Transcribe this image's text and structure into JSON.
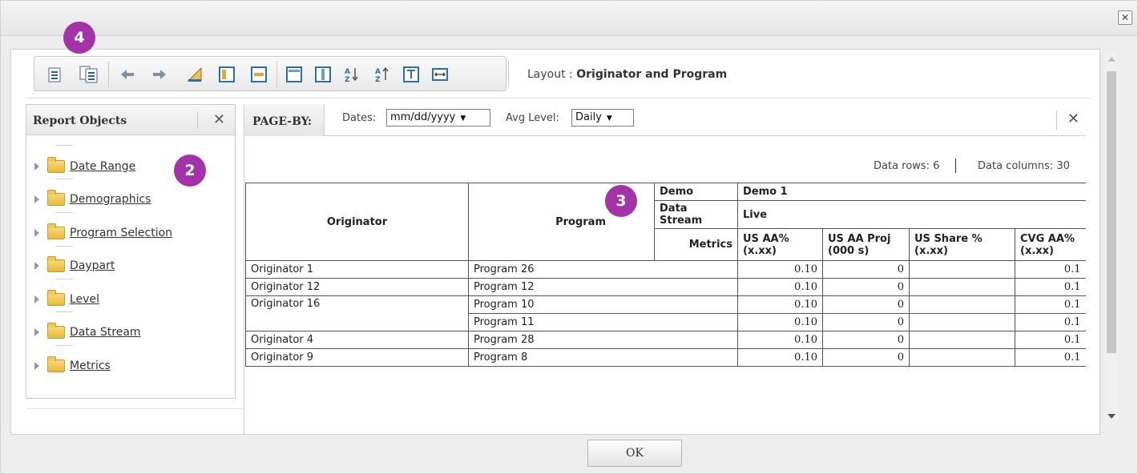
{
  "toolbar": {
    "layout_label": "Layout : ",
    "layout_name": "Originator and Program"
  },
  "report_objects": {
    "title": "Report Objects",
    "items": [
      {
        "label": "Date Range"
      },
      {
        "label": "Demographics"
      },
      {
        "label": "Program Selection"
      },
      {
        "label": "Daypart"
      },
      {
        "label": "Level"
      },
      {
        "label": "Data Stream"
      },
      {
        "label": "Metrics"
      }
    ]
  },
  "page_by": {
    "tag": "PAGE-BY:",
    "dates_label": "Dates:",
    "dates_value": "mm/dd/yyyy",
    "avg_label": "Avg Level:",
    "avg_value": "Daily"
  },
  "meta": {
    "rows": "Data rows: 6",
    "cols": "Data columns: 30"
  },
  "grid": {
    "headers": {
      "originator": "Originator",
      "program": "Program",
      "demo_label": "Demo",
      "demo_value": "Demo 1",
      "stream_label": "Data Stream",
      "stream_value": "Live",
      "metrics_label": "Metrics",
      "metric_cols": [
        "US AA% (x.xx)",
        "US AA Proj (000 s)",
        "US Share % (x.xx)",
        "CVG AA% (x.xx)"
      ]
    },
    "rows": [
      {
        "originator": "Originator 1",
        "program": "Program 26",
        "v1": "0.10",
        "v2": "0",
        "v3": "",
        "v4": "0.1"
      },
      {
        "originator": "Originator 12",
        "program": "Program 12",
        "v1": "0.10",
        "v2": "0",
        "v3": "",
        "v4": "0.1"
      },
      {
        "originator": "Originator 16",
        "program": "Program 10",
        "v1": "0.10",
        "v2": "0",
        "v3": "",
        "v4": "0.1"
      },
      {
        "originator": "",
        "program": "Program 11",
        "v1": "0.10",
        "v2": "0",
        "v3": "",
        "v4": "0.1"
      },
      {
        "originator": "Originator 4",
        "program": "Program 28",
        "v1": "0.10",
        "v2": "0",
        "v3": "",
        "v4": "0.1"
      },
      {
        "originator": "Originator 9",
        "program": "Program 8",
        "v1": "0.10",
        "v2": "0",
        "v3": "",
        "v4": "0.1"
      }
    ]
  },
  "footer": {
    "ok_label": "OK"
  },
  "badges": {
    "b4": "4",
    "b2": "2",
    "b3": "3"
  },
  "colors": {
    "badge": "#a432a8"
  }
}
